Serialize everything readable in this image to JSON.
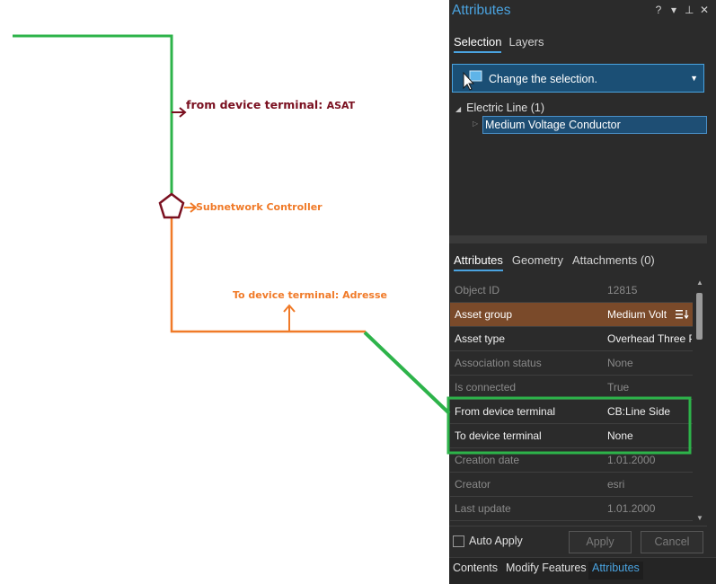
{
  "map": {
    "labels": {
      "from_terminal_key": "from device terminal: ",
      "from_terminal_value": "ASAT",
      "subnetwork_controller": "Subnetwork Controller",
      "to_terminal": "To device terminal: Adresse"
    },
    "colors": {
      "green_line": "#2db34a",
      "orange_line": "#f07a28",
      "dark_red": "#7a1020"
    }
  },
  "pane": {
    "title": "Attributes",
    "title_icons": [
      "help-icon",
      "dropdown-icon",
      "pin-icon",
      "close-icon"
    ],
    "title_icon_glyphs": [
      "?",
      "▾",
      "⊥",
      "✕"
    ],
    "top_tabs": [
      {
        "label": "Selection",
        "active": true
      },
      {
        "label": "Layers",
        "active": false
      }
    ],
    "selector_text": "Change the selection.",
    "tree": {
      "root": "Electric Line (1)",
      "child": "Medium Voltage Conductor"
    },
    "sub_tabs": [
      {
        "label": "Attributes",
        "active": true
      },
      {
        "label": "Geometry",
        "active": false
      },
      {
        "label": "Attachments (0)",
        "active": false
      }
    ],
    "rows": [
      {
        "key": "Object ID",
        "value": "12815",
        "style": "dim"
      },
      {
        "key": "Asset group",
        "value": "Medium Volt",
        "style": "hl"
      },
      {
        "key": "Asset type",
        "value": "Overhead Three P",
        "style": "lit"
      },
      {
        "key": "Association status",
        "value": "None",
        "style": "dim"
      },
      {
        "key": "Is connected",
        "value": "True",
        "style": "dim"
      },
      {
        "key": "From device terminal",
        "value": "CB:Line Side",
        "style": "lit"
      },
      {
        "key": "To device terminal",
        "value": "None",
        "style": "lit"
      },
      {
        "key": "Creation date",
        "value": "1.01.2000",
        "style": "dim"
      },
      {
        "key": "Creator",
        "value": "esri",
        "style": "dim"
      },
      {
        "key": "Last update",
        "value": "1.01.2000",
        "style": "dim"
      }
    ],
    "auto_apply_label": "Auto Apply",
    "apply_label": "Apply",
    "cancel_label": "Cancel",
    "footer_tabs": [
      {
        "label": "Contents",
        "active": false
      },
      {
        "label": "Modify Features",
        "active": false
      },
      {
        "label": "Attributes",
        "active": true
      }
    ],
    "colors": {
      "accent": "#4aa3e0",
      "highlight_row": "#7a4a2a",
      "selection_bg": "#1b4f75",
      "highlight_box": "#2db34a"
    }
  }
}
